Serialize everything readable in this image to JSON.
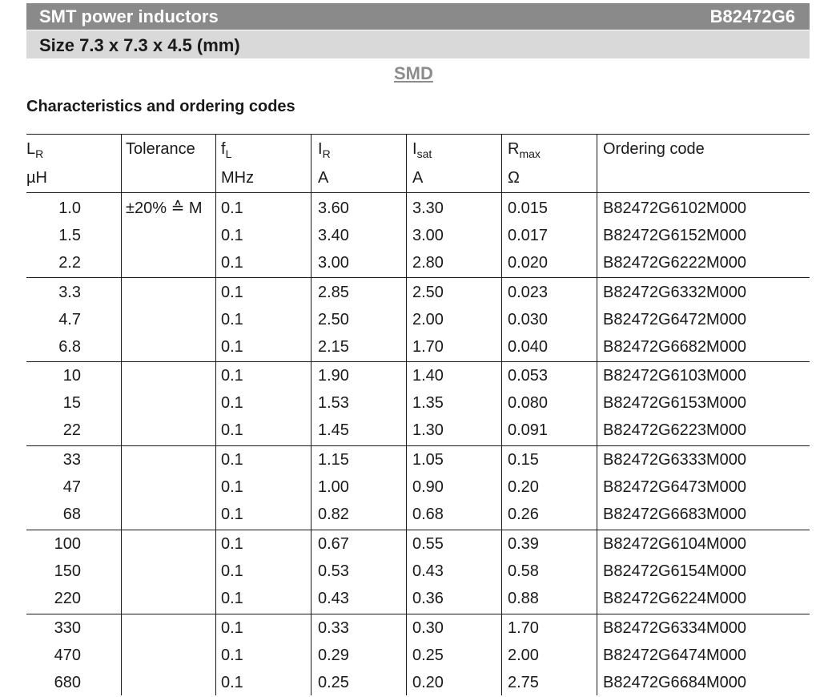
{
  "banner": {
    "title": "SMT power inductors",
    "part": "B82472G6"
  },
  "size_line": "Size 7.3 x 7.3 x 4.5 (mm)",
  "mount_type": "SMD",
  "section_title": "Characteristics and ordering codes",
  "columns": [
    {
      "sym": "L",
      "sub": "R",
      "unit": "µH"
    },
    {
      "sym": "Tolerance",
      "sub": "",
      "unit": ""
    },
    {
      "sym": "f",
      "sub": "L",
      "unit": "MHz"
    },
    {
      "sym": "I",
      "sub": "R",
      "unit": "A"
    },
    {
      "sym": "I",
      "sub": "sat",
      "unit": "A"
    },
    {
      "sym": "R",
      "sub": "max",
      "unit": "Ω"
    },
    {
      "sym": "Ordering code",
      "sub": "",
      "unit": ""
    }
  ],
  "tolerance": "±20% ≙ M",
  "rows": [
    [
      "1.0",
      "0.1",
      "3.60",
      "3.30",
      "0.015",
      "B82472G6102M000"
    ],
    [
      "1.5",
      "0.1",
      "3.40",
      "3.00",
      "0.017",
      "B82472G6152M000"
    ],
    [
      "2.2",
      "0.1",
      "3.00",
      "2.80",
      "0.020",
      "B82472G6222M000"
    ],
    [
      "3.3",
      "0.1",
      "2.85",
      "2.50",
      "0.023",
      "B82472G6332M000"
    ],
    [
      "4.7",
      "0.1",
      "2.50",
      "2.00",
      "0.030",
      "B82472G6472M000"
    ],
    [
      "6.8",
      "0.1",
      "2.15",
      "1.70",
      "0.040",
      "B82472G6682M000"
    ],
    [
      "10",
      "0.1",
      "1.90",
      "1.40",
      "0.053",
      "B82472G6103M000"
    ],
    [
      "15",
      "0.1",
      "1.53",
      "1.35",
      "0.080",
      "B82472G6153M000"
    ],
    [
      "22",
      "0.1",
      "1.45",
      "1.30",
      "0.091",
      "B82472G6223M000"
    ],
    [
      "33",
      "0.1",
      "1.15",
      "1.05",
      "0.15",
      "B82472G6333M000"
    ],
    [
      "47",
      "0.1",
      "1.00",
      "0.90",
      "0.20",
      "B82472G6473M000"
    ],
    [
      "68",
      "0.1",
      "0.82",
      "0.68",
      "0.26",
      "B82472G6683M000"
    ],
    [
      "100",
      "0.1",
      "0.67",
      "0.55",
      "0.39",
      "B82472G6104M000"
    ],
    [
      "150",
      "0.1",
      "0.53",
      "0.43",
      "0.58",
      "B82472G6154M000"
    ],
    [
      "220",
      "0.1",
      "0.43",
      "0.36",
      "0.88",
      "B82472G6224M000"
    ],
    [
      "330",
      "0.1",
      "0.33",
      "0.30",
      "1.70",
      "B82472G6334M000"
    ],
    [
      "470",
      "0.1",
      "0.29",
      "0.25",
      "2.00",
      "B82472G6474M000"
    ],
    [
      "680",
      "0.1",
      "0.25",
      "0.20",
      "2.75",
      "B82472G6684M000"
    ]
  ]
}
